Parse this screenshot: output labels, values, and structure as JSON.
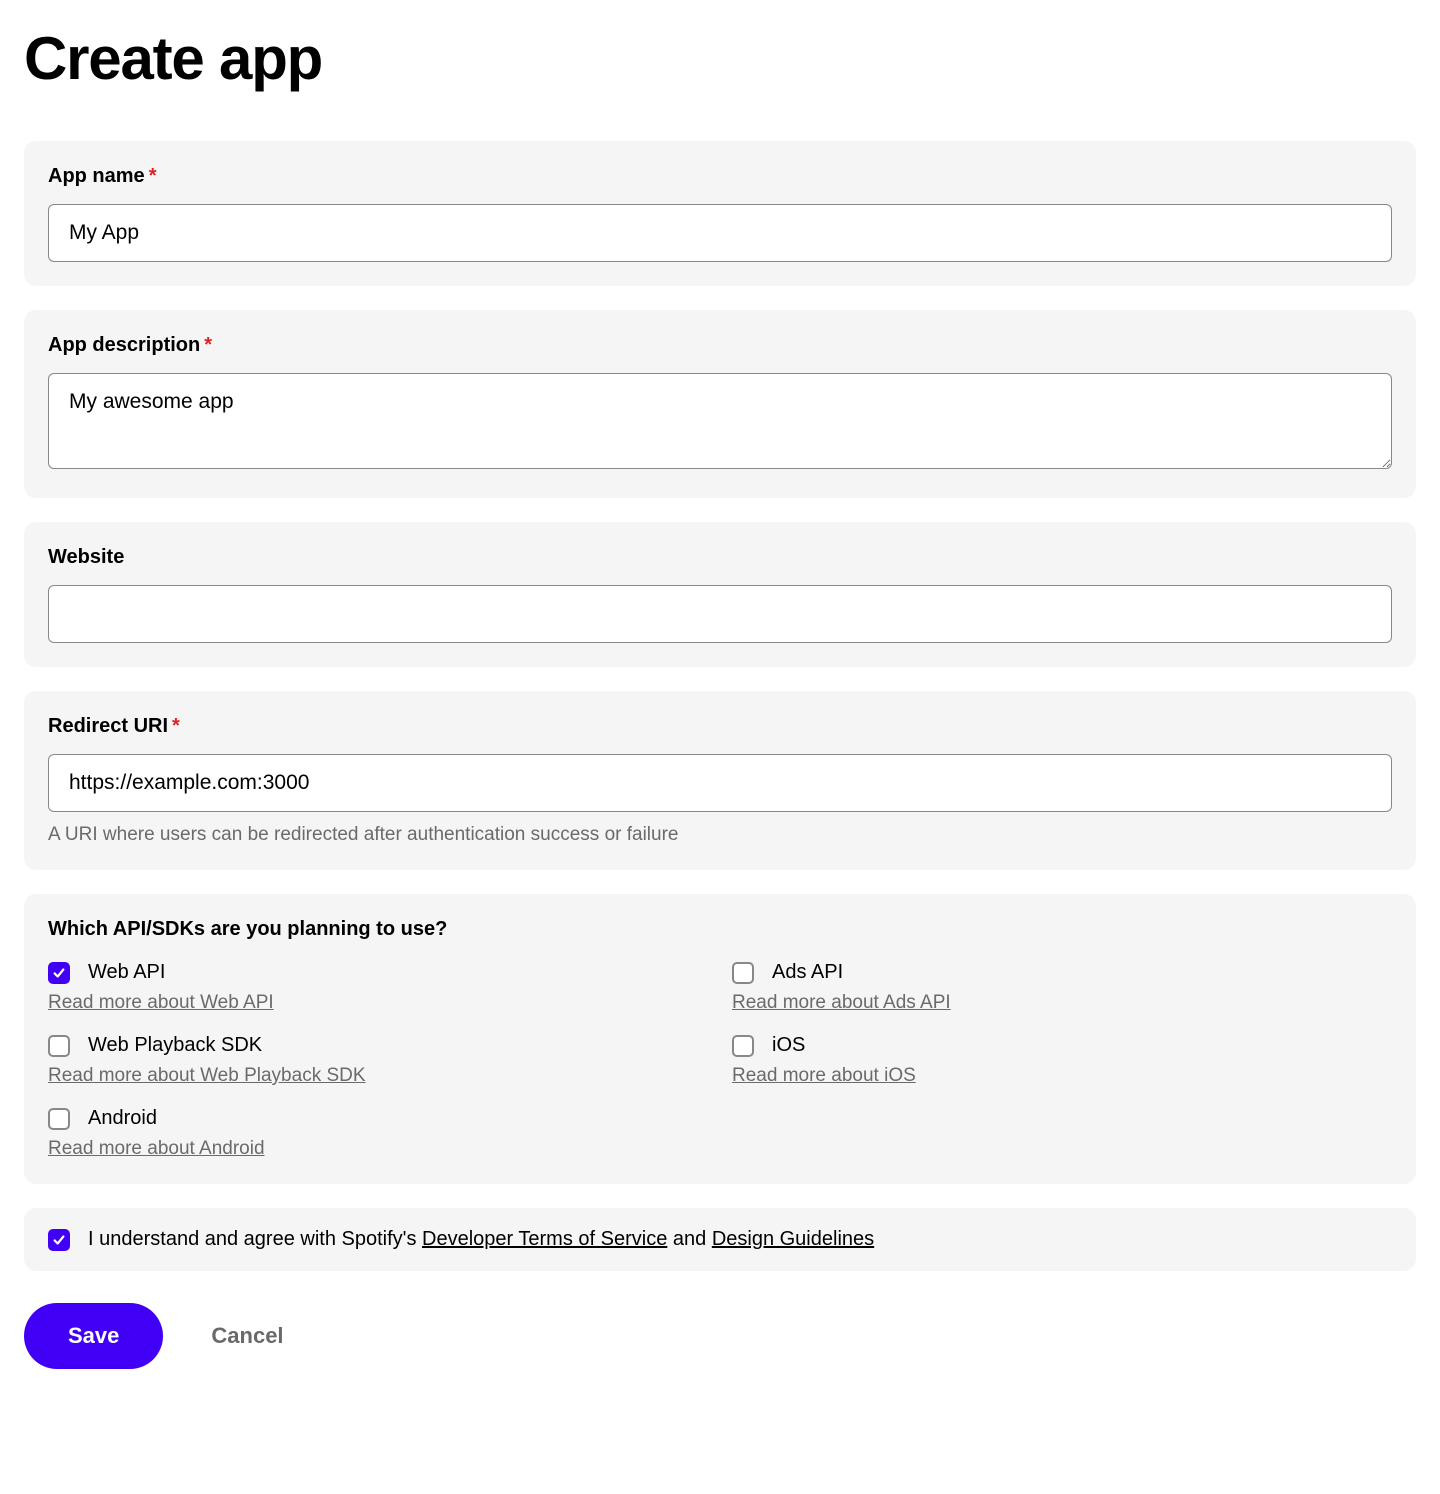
{
  "page": {
    "title": "Create app"
  },
  "fields": {
    "app_name": {
      "label": "App name",
      "required": true,
      "value": "My App"
    },
    "app_description": {
      "label": "App description",
      "required": true,
      "value": "My awesome app"
    },
    "website": {
      "label": "Website",
      "required": false,
      "value": ""
    },
    "redirect_uri": {
      "label": "Redirect URI",
      "required": true,
      "value": "https://example.com:3000",
      "helper": "A URI where users can be redirected after authentication success or failure"
    }
  },
  "sdks": {
    "question": "Which API/SDKs are you planning to use?",
    "items": [
      {
        "id": "web-api",
        "label": "Web API",
        "checked": true,
        "read_more": "Read more about Web API"
      },
      {
        "id": "ads-api",
        "label": "Ads API",
        "checked": false,
        "read_more": "Read more about Ads API"
      },
      {
        "id": "web-playback-sdk",
        "label": "Web Playback SDK",
        "checked": false,
        "read_more": "Read more about Web Playback SDK"
      },
      {
        "id": "ios",
        "label": "iOS",
        "checked": false,
        "read_more": "Read more about iOS"
      },
      {
        "id": "android",
        "label": "Android",
        "checked": false,
        "read_more": "Read more about Android"
      }
    ]
  },
  "agreement": {
    "checked": true,
    "prefix": "I understand and agree with Spotify's ",
    "tos_link": "Developer Terms of Service",
    "connector": " and ",
    "design_link": "Design Guidelines"
  },
  "buttons": {
    "save": "Save",
    "cancel": "Cancel"
  }
}
